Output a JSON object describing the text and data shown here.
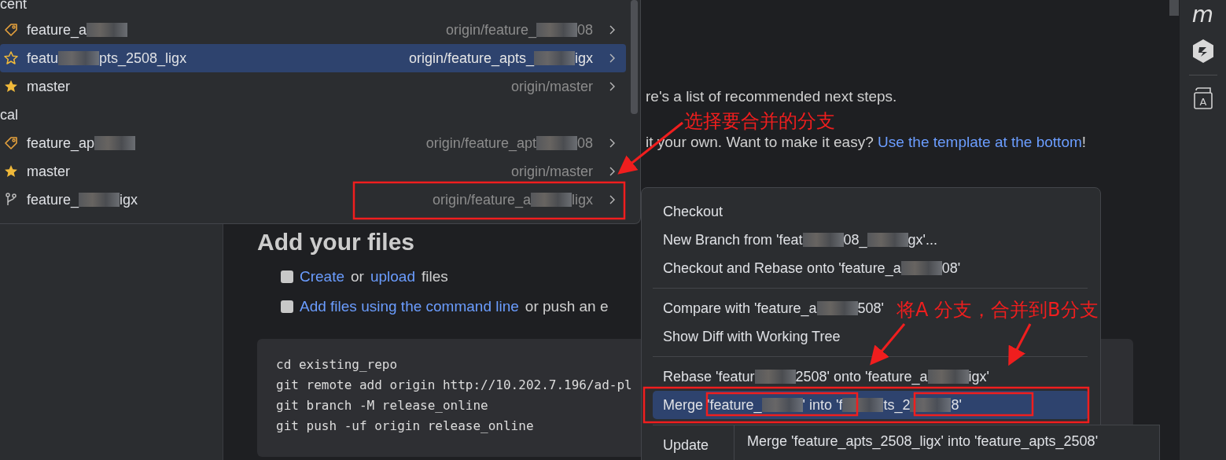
{
  "branch_popup": {
    "sections": [
      {
        "header": "cent",
        "rows": [
          {
            "kind": "tag",
            "name": "feature_a",
            "blurred": true,
            "remote": "origin/feature_",
            "remote_tail": "08",
            "remote_blurred": true,
            "selected": false
          },
          {
            "kind": "favorite",
            "name": "featu",
            "name_tail": "pts_2508_ligx",
            "blurred": true,
            "remote": "origin/feature_apts_",
            "remote_tail": "igx",
            "remote_blurred": true,
            "selected": true
          },
          {
            "kind": "starred",
            "name": "master",
            "remote": "origin/master",
            "selected": false
          }
        ]
      },
      {
        "header": "cal",
        "rows": [
          {
            "kind": "tag",
            "name": "feature_ap",
            "blurred": true,
            "remote": "origin/feature_apt",
            "remote_tail": "08",
            "remote_blurred": true,
            "selected": false
          },
          {
            "kind": "starred",
            "name": "master",
            "remote": "origin/master",
            "selected": false
          },
          {
            "kind": "branch",
            "name": "feature_",
            "name_tail": "igx",
            "blurred": true,
            "remote": "origin/feature_a",
            "remote_tail": "ligx",
            "remote_blurred": true,
            "selected": false
          }
        ]
      }
    ]
  },
  "page": {
    "line_1": "re's a list of recommended next steps.",
    "line_2": "it your own. Want to make it easy?",
    "line_2_link": "Use the template at the bottom",
    "line_2_end": "!",
    "heading": "Add your files",
    "tasks": [
      {
        "checked": false,
        "link": "Create",
        "mid": "or",
        "link2": "upload",
        "end": "files"
      },
      {
        "checked": false,
        "link": "Add files using the command line",
        "mid": "or push an e"
      }
    ],
    "code": [
      "cd existing_repo",
      "git remote add origin http://10.202.7.196/ad-pl",
      "git branch -M release_online",
      "git push -uf origin release_online"
    ]
  },
  "context_menu": {
    "groups": [
      [
        {
          "label": "Checkout",
          "selected": false
        },
        {
          "label": "New Branch from 'feat",
          "blurred": true,
          "tail": "08_",
          "tail2": "gx'...",
          "selected": false
        },
        {
          "label": "Checkout and Rebase onto 'feature_a",
          "blurred": true,
          "tail": "08'",
          "selected": false
        }
      ],
      [
        {
          "label": "Compare with 'feature_a",
          "blurred": true,
          "tail": "508'",
          "selected": false
        },
        {
          "label": "Show Diff with Working Tree",
          "selected": false
        }
      ],
      [
        {
          "label": "Rebase 'featur",
          "blurred": true,
          "tail": "2508' onto 'feature_a",
          "tail2": "igx'",
          "selected": false
        },
        {
          "label": "Merge 'feature_",
          "blurred": true,
          "tail": "' into 'f",
          "tail2": "ts_2",
          "tail3": "8'",
          "selected": true
        }
      ],
      [
        {
          "label": "Update",
          "selected": false
        }
      ]
    ]
  },
  "tooltip": "Merge 'feature_apts_2508_ligx' into 'feature_apts_2508'",
  "toolbar": {
    "logo": "m",
    "book_letter": "A"
  },
  "annotations": {
    "note_1": "选择要合并的分支",
    "note_2": "将A 分支，合并到B分支"
  }
}
